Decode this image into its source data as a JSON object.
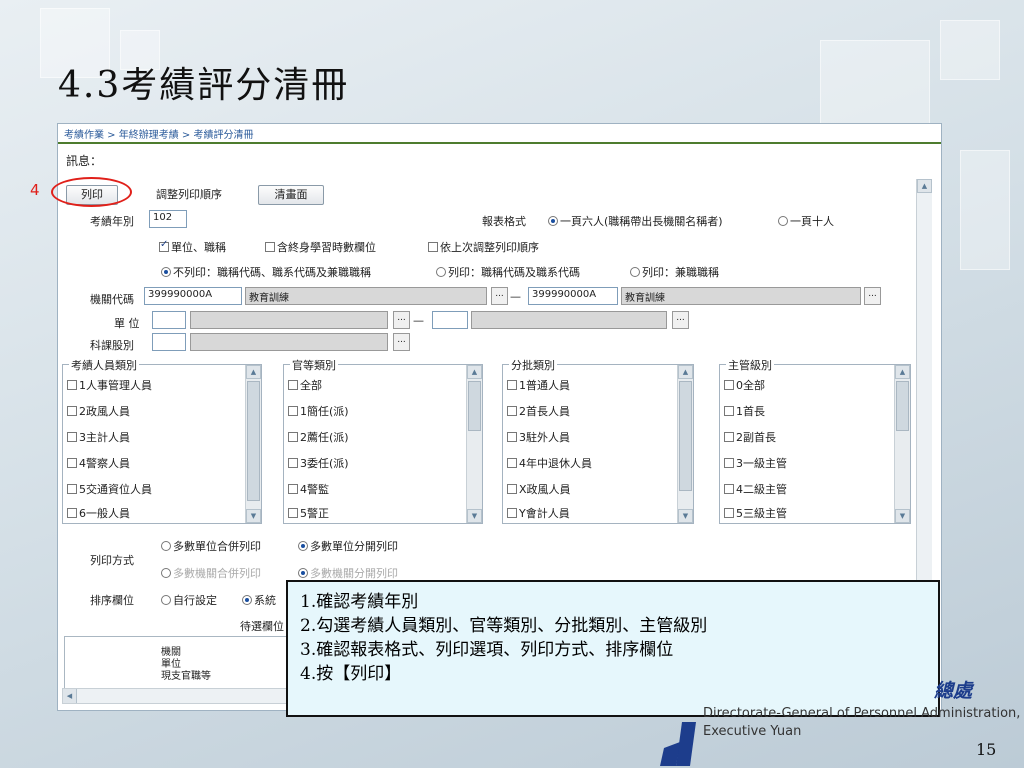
{
  "slide": {
    "title": "4.3考績評分清冊",
    "page_number": "15"
  },
  "screen": {
    "breadcrumb": "考績作業 > 年終辦理考績 > 考績評分清冊",
    "message_label": "訊息：",
    "buttons": {
      "print": "列印",
      "reorder": "調整列印順序",
      "clear": "清畫面"
    },
    "form": {
      "year_label": "考績年別",
      "year_value": "102",
      "report_format_label": "報表格式",
      "format_opt1": "一頁六人(職稱帶出長機關名稱者)",
      "format_opt2": "一頁十人",
      "chk_unit_title": "單位、職稱",
      "chk_lifelong": "含終身學習時數欄位",
      "chk_last_order": "依上次調整列印順序",
      "radio_no_print": "不列印：職稱代碼、職系代碼及兼職職稱",
      "radio_print_codes": "列印：職稱代碼及職系代碼",
      "radio_print_concurrent": "列印：兼職職稱",
      "agency_label": "機關代碼",
      "agency_code_from": "399990000A",
      "agency_name_from": "教育訓練",
      "agency_code_to": "399990000A",
      "agency_name_to": "教育訓練",
      "dots": "...",
      "unit_label": "單  位",
      "section_label": "科課股別"
    },
    "groups": [
      {
        "legend": "考績人員類別",
        "items": [
          "1人事管理人員",
          "2政風人員",
          "3主計人員",
          "4警察人員",
          "5交通資位人員",
          "6一般人員"
        ]
      },
      {
        "legend": "官等類別",
        "items": [
          "全部",
          "1簡任(派)",
          "2薦任(派)",
          "3委任(派)",
          "4警監",
          "5警正"
        ]
      },
      {
        "legend": "分批類別",
        "items": [
          "1普通人員",
          "2首長人員",
          "3駐外人員",
          "4年中退休人員",
          "X政風人員",
          "Y會計人員"
        ]
      },
      {
        "legend": "主管級別",
        "items": [
          "0全部",
          "1首長",
          "2副首長",
          "3一級主管",
          "4二級主管",
          "5三級主管"
        ]
      }
    ],
    "print_mode": {
      "label": "列印方式",
      "opt1": "多數單位合併列印",
      "opt2": "多數單位分開列印",
      "opt3": "多數機關合併列印",
      "opt4": "多數機關分開列印"
    },
    "sort": {
      "label": "排序欄位",
      "opt1": "自行設定",
      "opt2": "系統",
      "pending_label": "待選欄位",
      "list_items": [
        "機關",
        "單位",
        "現支官職等"
      ]
    }
  },
  "marker": {
    "number": "4"
  },
  "callout": {
    "lines": [
      "1.確認考績年別",
      "2.勾選考績人員類別、官等類別、分批類別、主管級別",
      "3.確認報表格式、列印選項、列印方式、排序欄位",
      "4.按【列印】"
    ]
  },
  "org": {
    "name_fragment": "總處",
    "line1": "Directorate-General of Personnel Administration,",
    "line2": "Executive Yuan"
  }
}
